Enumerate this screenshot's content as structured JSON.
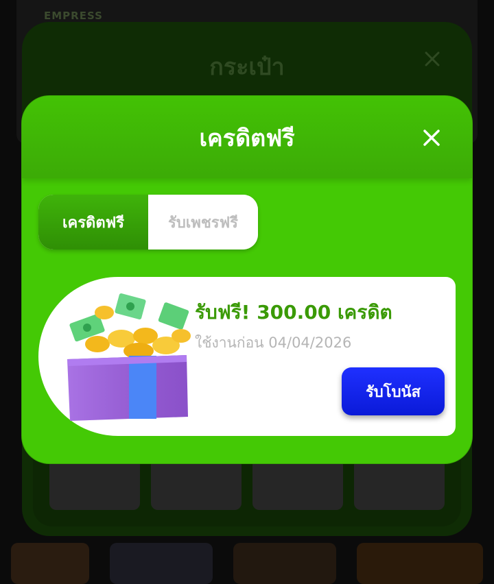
{
  "background": {
    "logo_text": "EMPRESS"
  },
  "wallet_modal": {
    "title": "กระเป๋า",
    "close_icon": "close-icon"
  },
  "credit_modal": {
    "title": "เครดิตฟรี",
    "close_icon": "close-icon",
    "tabs": [
      {
        "label": "เครดิตฟรี",
        "active": true
      },
      {
        "label": "รับเพชรฟรี",
        "active": false
      }
    ],
    "bonus": {
      "title": "รับฟรี! 300.00 เครดิต",
      "expire": "ใช้งานก่อน 04/04/2026",
      "claim_label": "รับโบนัส",
      "icon": "gift-box-icon"
    }
  },
  "colors": {
    "modal_green": "#44c905",
    "title_green": "#3a9a06",
    "claim_blue": "#0a1ad8",
    "overlay": "#0b0b0b"
  }
}
